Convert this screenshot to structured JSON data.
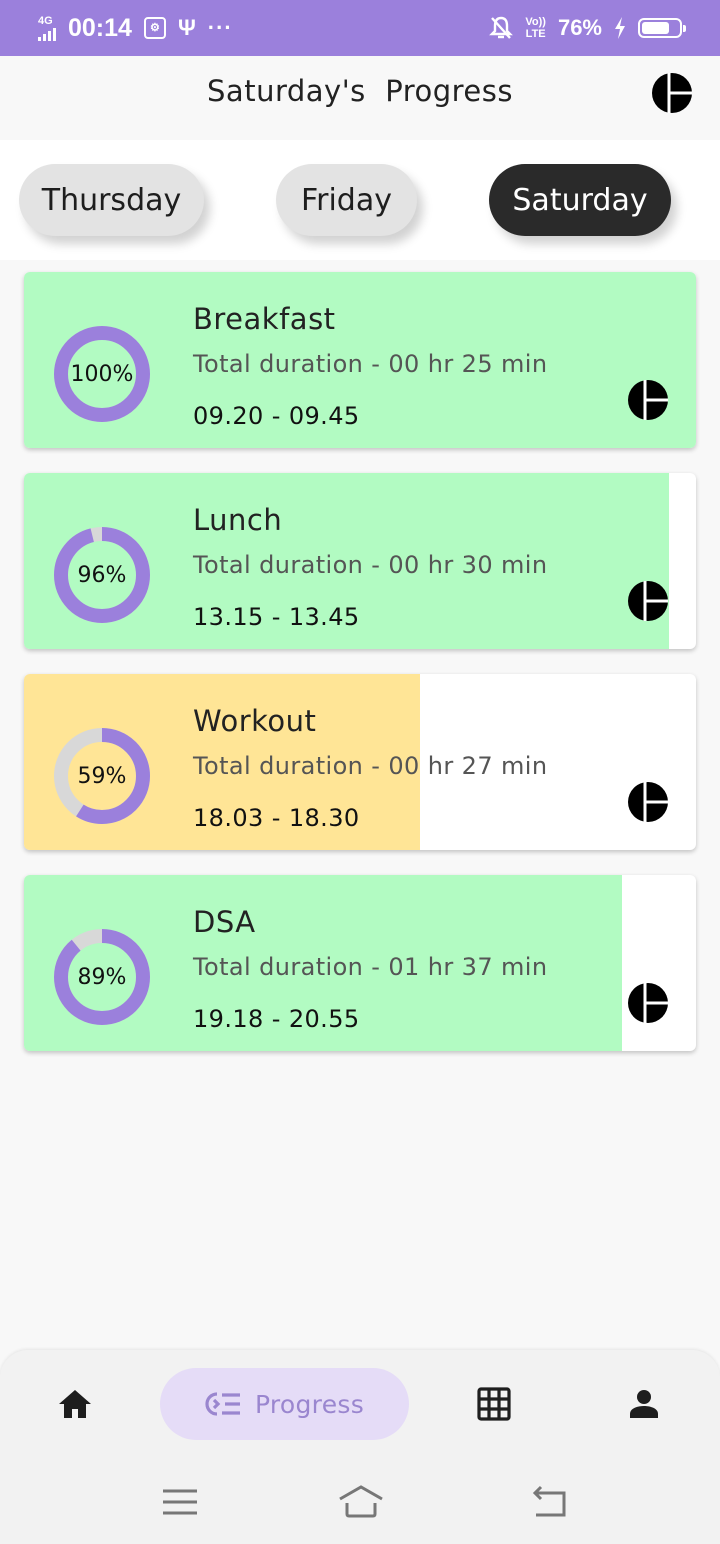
{
  "status_bar": {
    "network": "4G",
    "time": "00:14",
    "battery_percent": "76%",
    "battery_level": 0.76,
    "lte_label_top": "Vo))",
    "lte_label_bottom": "LTE",
    "more_indicator": "···",
    "icons": [
      "signal-icon",
      "usb-debug-icon",
      "usb-icon",
      "more-dots-icon",
      "mute-icon",
      "volte-icon",
      "charging-icon",
      "battery-icon"
    ]
  },
  "header": {
    "title": "Saturday's  Progress",
    "logo_icon": "app-logo-icon"
  },
  "day_tabs": [
    {
      "label": "Thursday",
      "active": false
    },
    {
      "label": "Friday",
      "active": false
    },
    {
      "label": "Saturday",
      "active": true
    }
  ],
  "activities": [
    {
      "title": "Breakfast",
      "duration": "Total duration - 00 hr 25 min",
      "time_range": "09.20 - 09.45",
      "percent_label": "100%",
      "percent": 100,
      "color": "#b2fbc2"
    },
    {
      "title": "Lunch",
      "duration": "Total duration - 00 hr 30 min",
      "time_range": "13.15 - 13.45",
      "percent_label": "96%",
      "percent": 96,
      "color": "#b2fbc2"
    },
    {
      "title": "Workout",
      "duration": "Total duration - 00 hr 27 min",
      "time_range": "18.03 - 18.30",
      "percent_label": "59%",
      "percent": 59,
      "color": "#ffe596"
    },
    {
      "title": "DSA",
      "duration": "Total duration - 01 hr 37 min",
      "time_range": "19.18 - 20.55",
      "percent_label": "89%",
      "percent": 89,
      "color": "#b2fbc2"
    }
  ],
  "colors": {
    "status_bar": "#9b80dc",
    "ring_progress": "#9b80dc",
    "ring_track": "#d8d8d8",
    "active_tab": "#2a2a2a",
    "nav_pill": "#e5dcf7"
  },
  "bottom_nav": {
    "items": [
      {
        "icon": "home-icon",
        "label": ""
      },
      {
        "icon": "progress-icon",
        "label": "Progress",
        "active": true
      },
      {
        "icon": "grid-icon",
        "label": ""
      },
      {
        "icon": "profile-icon",
        "label": ""
      }
    ]
  },
  "system_nav": {
    "icons": [
      "menu-icon",
      "home-outline-icon",
      "back-icon"
    ]
  }
}
